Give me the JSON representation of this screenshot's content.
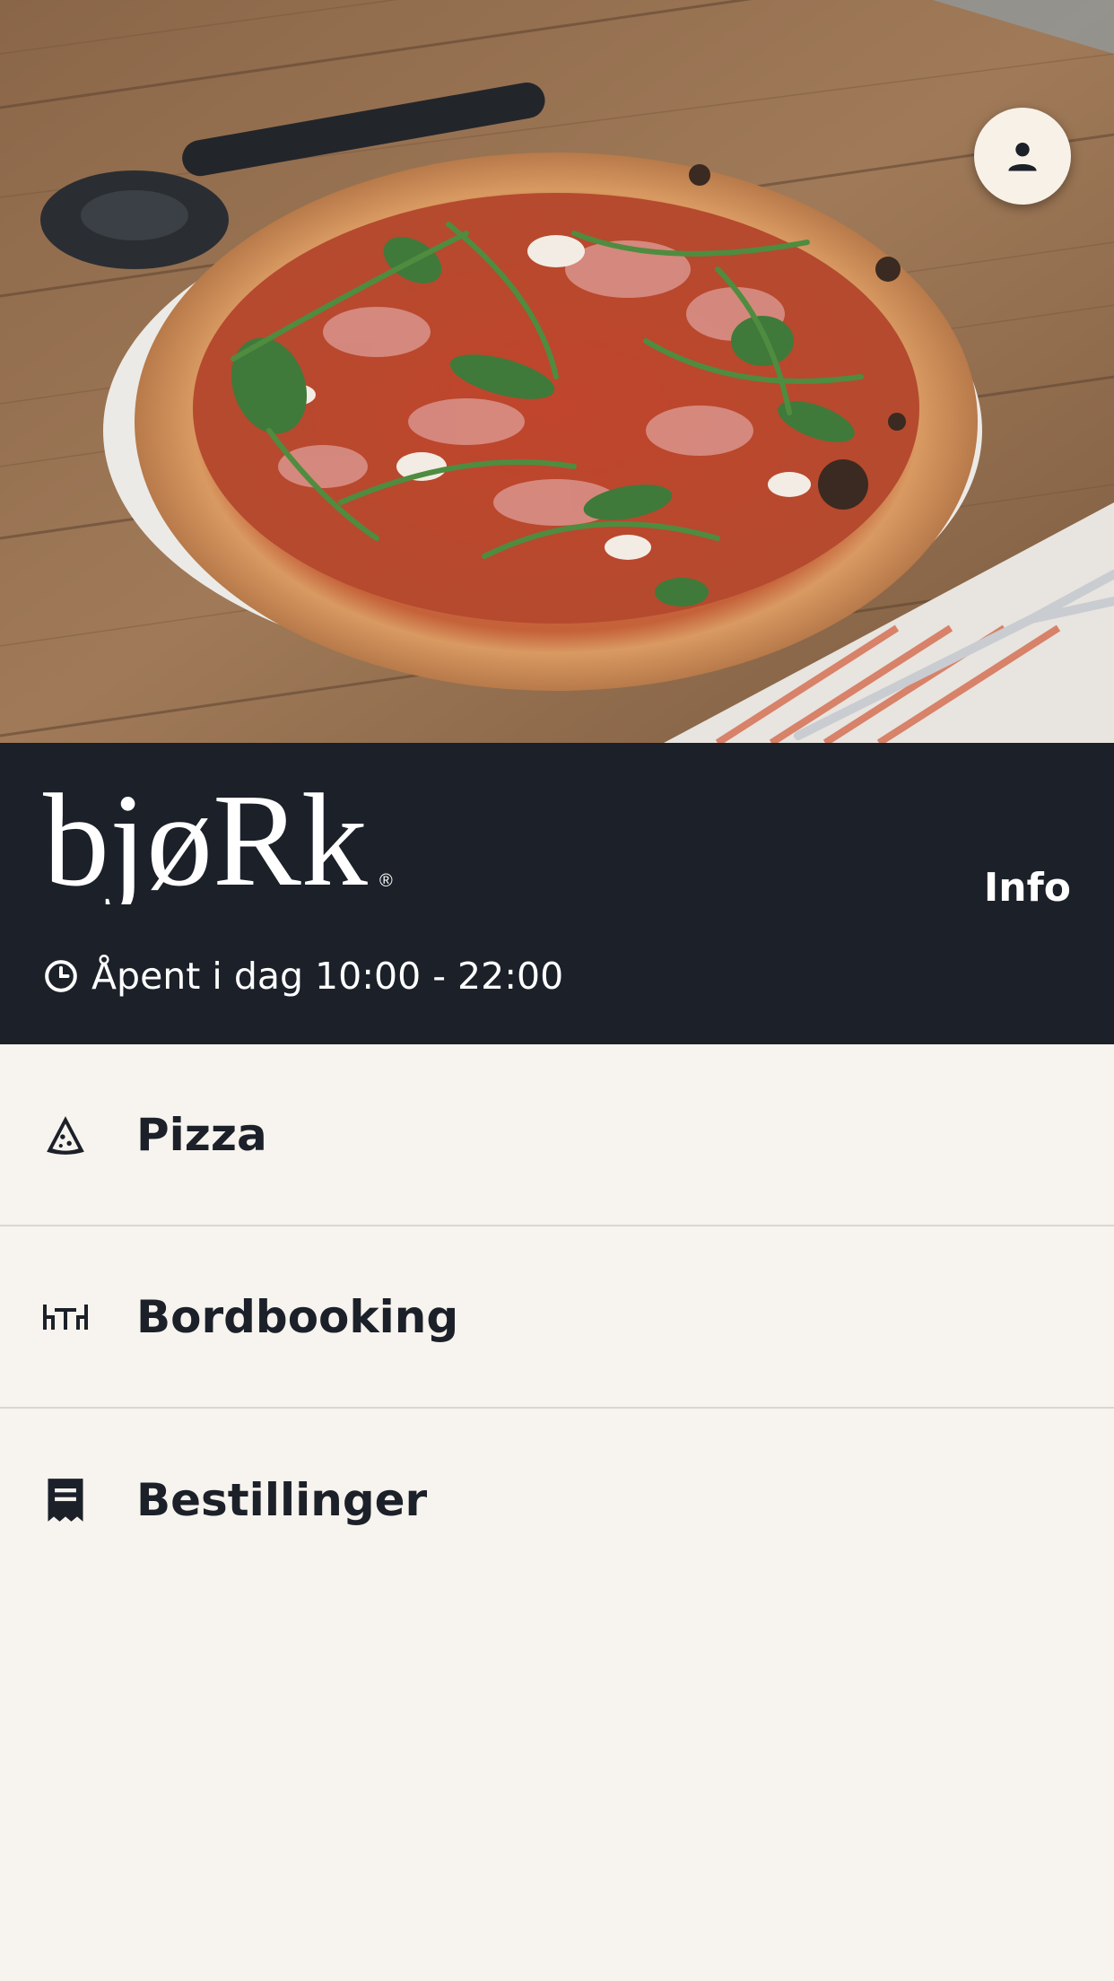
{
  "hero": {
    "image": "pizza-with-arugula-and-prosciutto-on-wooden-table"
  },
  "profile": {
    "icon": "person-icon"
  },
  "brand": {
    "logo_text": "bjøRk",
    "logo_mark": "®",
    "info_label": "Info",
    "hours_text": "Åpent i dag 10:00 - 22:00",
    "hours_icon": "clock-icon"
  },
  "menu": {
    "items": [
      {
        "label": "Pizza",
        "icon": "pizza-slice-icon"
      },
      {
        "label": "Bordbooking",
        "icon": "table-icon"
      },
      {
        "label": "Bestillinger",
        "icon": "receipt-icon"
      }
    ]
  },
  "colors": {
    "header_bg": "#1b2029",
    "page_bg": "#f7f3ee",
    "text_dark": "#1b2029",
    "divider": "#d9d7d3"
  }
}
